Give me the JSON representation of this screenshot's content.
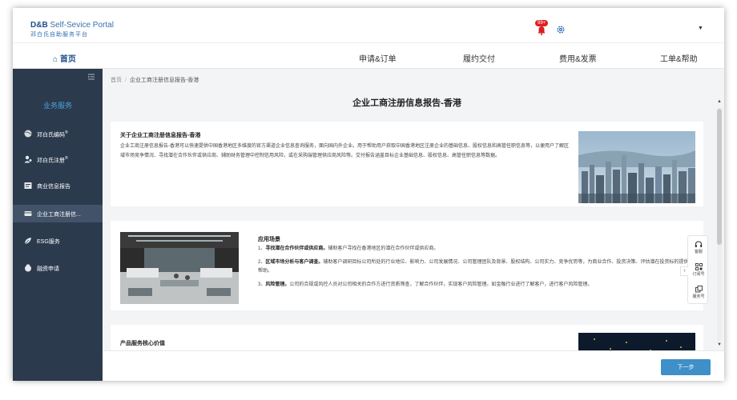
{
  "header": {
    "logo_brand": "D&B",
    "logo_suffix": " Self-Sevice Portal",
    "logo_sub": "邓白氏自助服务平台",
    "notification_count": "99+",
    "icons": [
      "bell-icon",
      "gear-icon",
      "chevron-down-icon"
    ],
    "accent_color": "#1c4c8c"
  },
  "nav": {
    "home": "首页",
    "items": [
      "申请&订单",
      "履约交付",
      "费用&发票",
      "工单&帮助"
    ]
  },
  "sidebar": {
    "title": "业务服务",
    "items": [
      {
        "label": "邓白氏编码",
        "sup": "®",
        "icon": "globe-icon"
      },
      {
        "label": "邓白氏注册",
        "sup": "®",
        "icon": "user-icon"
      },
      {
        "label": "商业信息报告",
        "sup": "",
        "icon": "report-icon"
      },
      {
        "label": "企业工商注册信...",
        "sup": "",
        "icon": "card-icon"
      },
      {
        "label": "ESG服务",
        "sup": "",
        "icon": "leaf-icon"
      },
      {
        "label": "融资申请",
        "sup": "",
        "icon": "finance-icon"
      }
    ],
    "active_index": 3,
    "bg_color": "#2b3a4d"
  },
  "breadcrumb": {
    "home": "首页",
    "separator": "/",
    "current": "企业工商注册信息报告-香港"
  },
  "page": {
    "title": "企业工商注册信息报告-香港"
  },
  "about": {
    "title": "关于企业工商注册信息报告-香港",
    "text": "企业工商注册信息报告-香港可以快速提供中国香港地区多维度的官方渠道企业信息查询服务，面向国内外企业。用于帮助用户获取中国香港地区注册企业的基础信息、股权信息和高管任职信息等，以便用户了解区域市场竞争情况、寻找潜在合作伙伴或供应商、辅助财务管理中控制信用风险，或在采购端管理供应商风险等。交付报告涵盖目标企业基础信息、股权信息、高管任职信息等数据。"
  },
  "usage": {
    "title": "应用场景",
    "items": [
      {
        "num": "1、",
        "bold": "寻找潜在合作伙伴或供应商。",
        "text": "辅助客户寻找在香港地区的潜在合作伙伴或供应商。"
      },
      {
        "num": "2、",
        "bold": "区域市场分析与客户调查。",
        "text": "辅助客户调研目标公司所处的行业地位、影响力、公司发展情况、公司管理团队及背景、股权结构、公司实力、竞争优势等，为商业合作、投资决策、评估潜在投资标的提供帮助。"
      },
      {
        "num": "3、",
        "bold": "风险管理。",
        "text": "公司的合规或风控人员对公司相关的合作方进行资质筛查，了解合作伙伴，实现客户风险管理。如金融行业进行了解客户，进行客户风险管理。"
      }
    ]
  },
  "value": {
    "title": "产品服务核心价值"
  },
  "float_panel": {
    "items": [
      "客服",
      "订阅号",
      "服务号"
    ],
    "icons": [
      "headset-icon",
      "qrcode-icon",
      "copy-icon"
    ]
  },
  "footer": {
    "next_label": "下一步",
    "button_color": "#3f8fc8"
  }
}
